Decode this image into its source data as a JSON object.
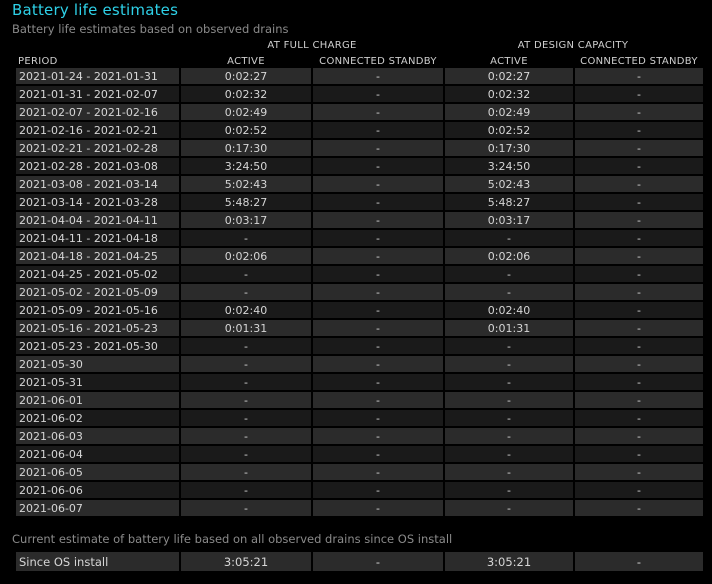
{
  "title": "Battery life estimates",
  "subtitle": "Battery life estimates based on observed drains",
  "groups": {
    "full_charge": "AT FULL CHARGE",
    "design_capacity": "AT DESIGN CAPACITY"
  },
  "columns": {
    "period": "PERIOD",
    "active_full": "ACTIVE",
    "standby_full": "CONNECTED STANDBY",
    "active_design": "ACTIVE",
    "standby_design": "CONNECTED STANDBY"
  },
  "rows": [
    [
      "2021-01-24 - 2021-01-31",
      "0:02:27",
      "-",
      "0:02:27",
      "-"
    ],
    [
      "2021-01-31 - 2021-02-07",
      "0:02:32",
      "-",
      "0:02:32",
      "-"
    ],
    [
      "2021-02-07 - 2021-02-16",
      "0:02:49",
      "-",
      "0:02:49",
      "-"
    ],
    [
      "2021-02-16 - 2021-02-21",
      "0:02:52",
      "-",
      "0:02:52",
      "-"
    ],
    [
      "2021-02-21 - 2021-02-28",
      "0:17:30",
      "-",
      "0:17:30",
      "-"
    ],
    [
      "2021-02-28 - 2021-03-08",
      "3:24:50",
      "-",
      "3:24:50",
      "-"
    ],
    [
      "2021-03-08 - 2021-03-14",
      "5:02:43",
      "-",
      "5:02:43",
      "-"
    ],
    [
      "2021-03-14 - 2021-03-28",
      "5:48:27",
      "-",
      "5:48:27",
      "-"
    ],
    [
      "2021-04-04 - 2021-04-11",
      "0:03:17",
      "-",
      "0:03:17",
      "-"
    ],
    [
      "2021-04-11 - 2021-04-18",
      "-",
      "-",
      "-",
      "-"
    ],
    [
      "2021-04-18 - 2021-04-25",
      "0:02:06",
      "-",
      "0:02:06",
      "-"
    ],
    [
      "2021-04-25 - 2021-05-02",
      "-",
      "-",
      "-",
      "-"
    ],
    [
      "2021-05-02 - 2021-05-09",
      "-",
      "-",
      "-",
      "-"
    ],
    [
      "2021-05-09 - 2021-05-16",
      "0:02:40",
      "-",
      "0:02:40",
      "-"
    ],
    [
      "2021-05-16 - 2021-05-23",
      "0:01:31",
      "-",
      "0:01:31",
      "-"
    ],
    [
      "2021-05-23 - 2021-05-30",
      "-",
      "-",
      "-",
      "-"
    ],
    [
      "2021-05-30",
      "-",
      "-",
      "-",
      "-"
    ],
    [
      "2021-05-31",
      "-",
      "-",
      "-",
      "-"
    ],
    [
      "2021-06-01",
      "-",
      "-",
      "-",
      "-"
    ],
    [
      "2021-06-02",
      "-",
      "-",
      "-",
      "-"
    ],
    [
      "2021-06-03",
      "-",
      "-",
      "-",
      "-"
    ],
    [
      "2021-06-04",
      "-",
      "-",
      "-",
      "-"
    ],
    [
      "2021-06-05",
      "-",
      "-",
      "-",
      "-"
    ],
    [
      "2021-06-06",
      "-",
      "-",
      "-",
      "-"
    ],
    [
      "2021-06-07",
      "-",
      "-",
      "-",
      "-"
    ]
  ],
  "footer_note": "Current estimate of battery life based on all observed drains since OS install",
  "total": [
    "Since OS install",
    "3:05:21",
    "-",
    "3:05:21",
    "-"
  ],
  "colors": {
    "title": "#2ed1e8",
    "row_odd": "#2b2b2b",
    "row_even": "#1a1a1a",
    "background": "#000000"
  }
}
